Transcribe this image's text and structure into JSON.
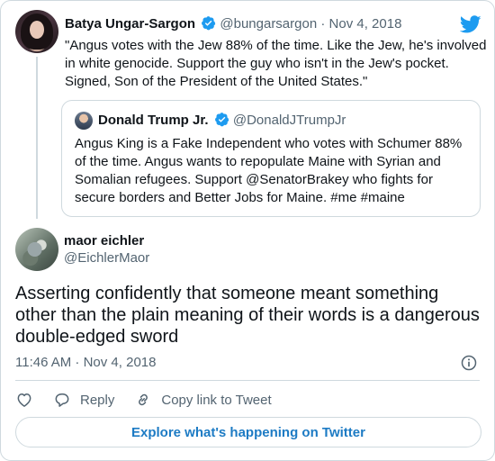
{
  "parent_tweet": {
    "name": "Batya Ungar-Sargon",
    "handle": "@bungarsargon",
    "separator": "·",
    "date": "Nov 4, 2018",
    "text": "\"Angus votes with the Jew 88% of the time. Like the Jew, he's involved in white genocide. Support the guy who isn't in the Jew's pocket. Signed, Son of the President of the United States.\"",
    "quoted": {
      "name": "Donald Trump Jr.",
      "handle": "@DonaldJTrumpJr",
      "text": "Angus King is a Fake Independent who votes with Schumer 88% of the time. Angus wants to repopulate Maine with Syrian and Somalian refugees. Support @SenatorBrakey who fights for secure borders and Better Jobs for Maine. #me #maine"
    }
  },
  "main_tweet": {
    "name": "maor eichler",
    "handle": "@EichlerMaor",
    "text": "Asserting confidently that someone meant something other than the plain meaning of their words is a dangerous double-edged sword",
    "timestamp": "11:46 AM · Nov 4, 2018"
  },
  "actions": {
    "reply_label": "Reply",
    "copy_link_label": "Copy link to Tweet"
  },
  "explore_label": "Explore what's happening on Twitter",
  "colors": {
    "verified_blue": "#1d9bf0",
    "link_blue": "#1d7bc4",
    "muted": "#536471",
    "border": "#cfd9de"
  },
  "icons": [
    "twitter-bird-icon",
    "verified-icon",
    "info-icon",
    "heart-icon",
    "reply-icon",
    "link-icon"
  ]
}
